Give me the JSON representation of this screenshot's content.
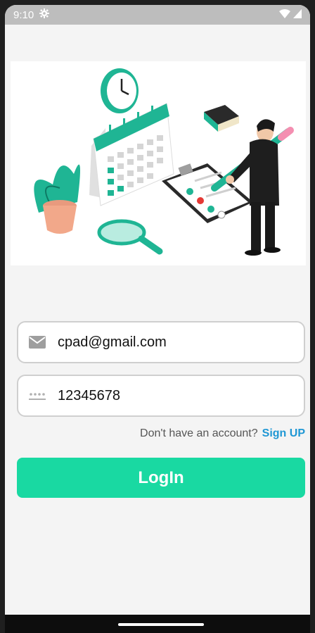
{
  "status_bar": {
    "time": "9:10",
    "icons": [
      "gear-icon",
      "wifi-icon",
      "signal-icon"
    ]
  },
  "illustration": {
    "description_icon": "scheduling-illustration"
  },
  "form": {
    "email": {
      "value": "cpad@gmail.com",
      "icon": "mail-icon"
    },
    "password": {
      "value": "12345678",
      "icon": "password-icon"
    }
  },
  "signup": {
    "prompt": "Don't have an account?",
    "link": "Sign UP"
  },
  "login": {
    "label": "LogIn"
  },
  "colors": {
    "accent": "#19d9a2",
    "link": "#1f97d4"
  }
}
